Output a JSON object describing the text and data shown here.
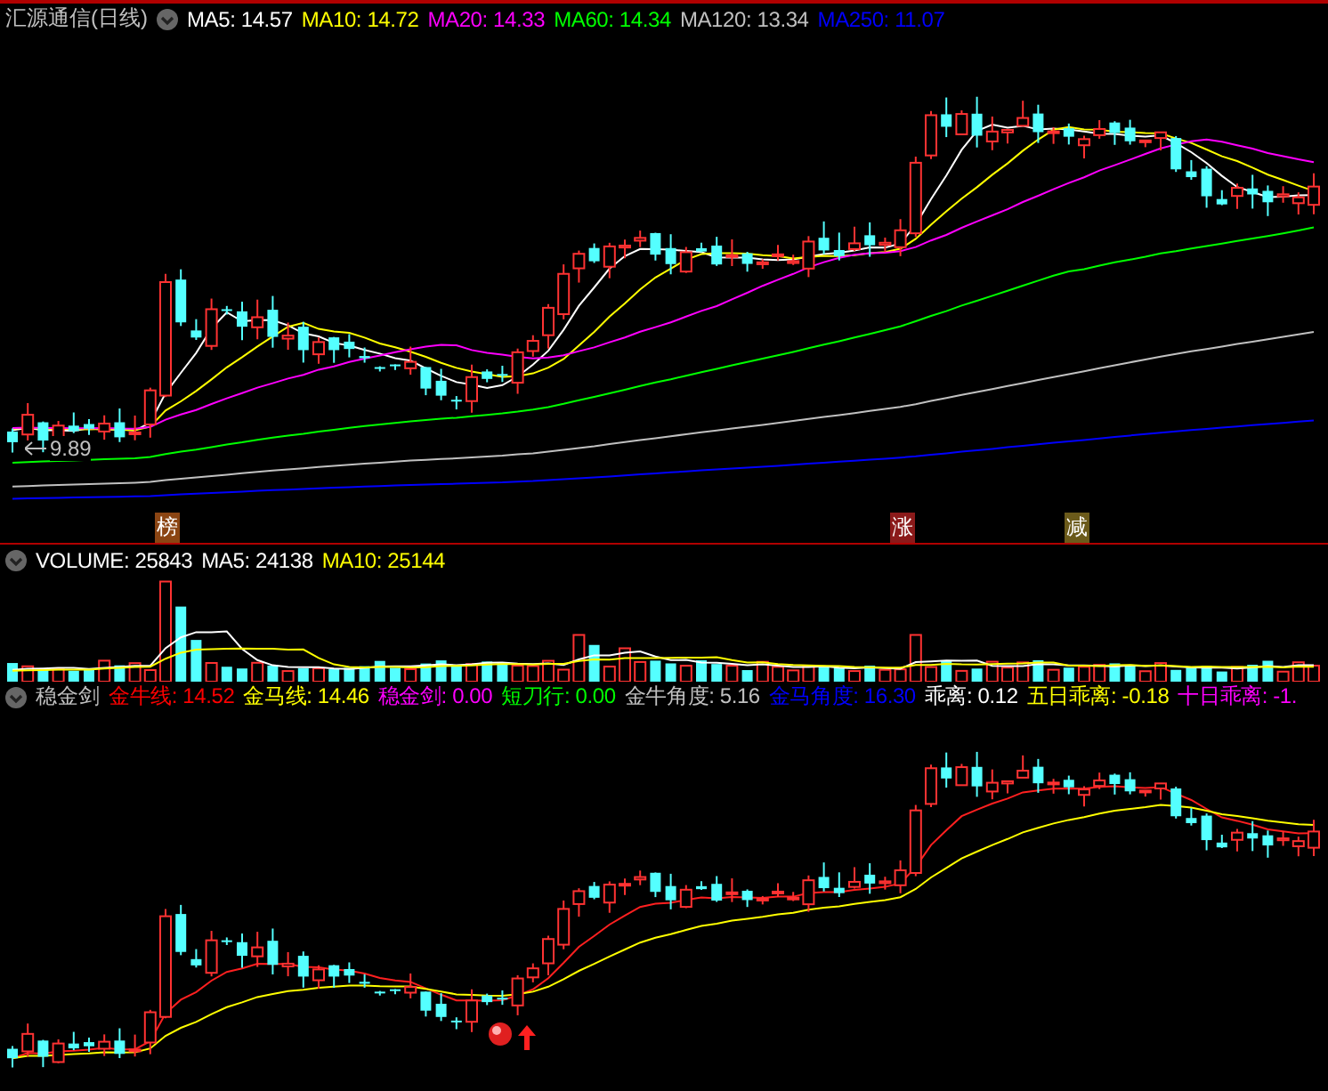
{
  "main_panel": {
    "title": "汇源通信(日线)",
    "indicators": [
      {
        "label": "MA5: 14.57",
        "color": "#ffffff"
      },
      {
        "label": "MA10: 14.72",
        "color": "#ffff00"
      },
      {
        "label": "MA20: 14.33",
        "color": "#ff00ff"
      },
      {
        "label": "MA60: 14.34",
        "color": "#00ff00"
      },
      {
        "label": "MA120: 13.34",
        "color": "#c0c0c0"
      },
      {
        "label": "MA250: 11.07",
        "color": "#0000ff"
      }
    ],
    "price_label": "9.89"
  },
  "markers": [
    {
      "label": "榜",
      "color": "#8b4513"
    },
    {
      "label": "涨",
      "color": "#8b1a1a"
    },
    {
      "label": "减",
      "color": "#6b5a1a"
    }
  ],
  "volume_panel": {
    "indicators": [
      {
        "label": "VOLUME: 25843",
        "color": "#ffffff"
      },
      {
        "label": "MA5: 24138",
        "color": "#ffffff"
      },
      {
        "label": "MA10: 25144",
        "color": "#ffff00"
      }
    ]
  },
  "indicator_panel": {
    "title": "稳金剑",
    "indicators": [
      {
        "label": "金牛线: 14.52",
        "color": "#ff0000"
      },
      {
        "label": "金马线: 14.46",
        "color": "#ffff00"
      },
      {
        "label": "稳金剑: 0.00",
        "color": "#ff00ff"
      },
      {
        "label": "短刀行: 0.00",
        "color": "#00ff00"
      },
      {
        "label": "金牛角度: 5.16",
        "color": "#c0c0c0"
      },
      {
        "label": "金马角度: 16.30",
        "color": "#0000ff"
      },
      {
        "label": "乖离: 0.12",
        "color": "#ffffff"
      },
      {
        "label": "五日乖离: -0.18",
        "color": "#ffff00"
      },
      {
        "label": "十日乖离: -1.",
        "color": "#ff00ff"
      }
    ]
  }
}
